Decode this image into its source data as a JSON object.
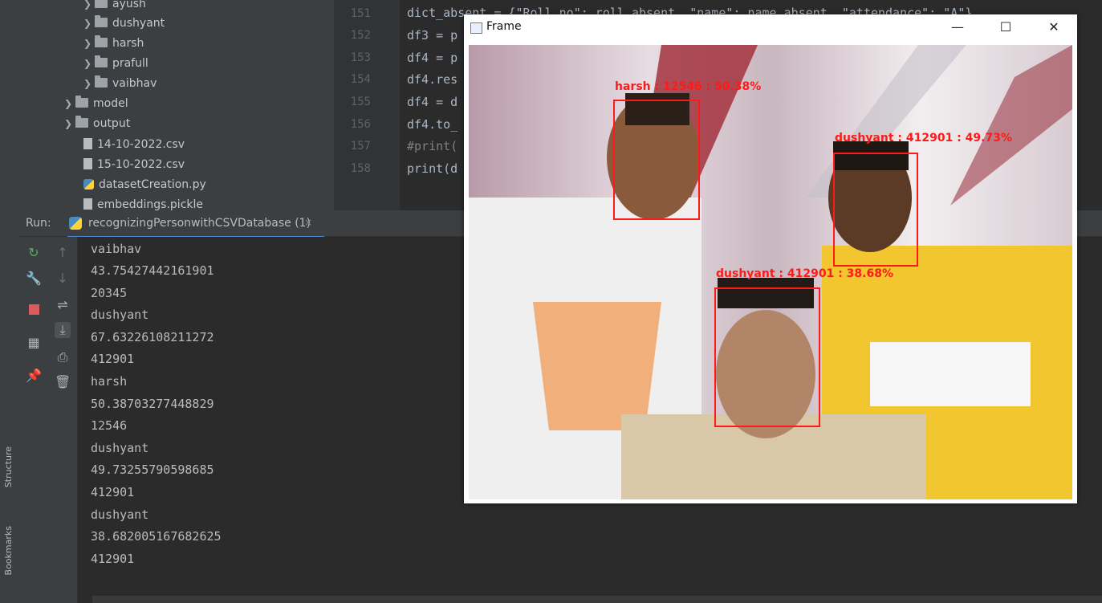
{
  "side_tabs": {
    "structure": "Structure",
    "bookmarks": "Bookmarks"
  },
  "project_tree": [
    {
      "label": "ayush",
      "type": "folder",
      "depth": 2
    },
    {
      "label": "dushyant",
      "type": "folder",
      "depth": 2
    },
    {
      "label": "harsh",
      "type": "folder",
      "depth": 2
    },
    {
      "label": "prafull",
      "type": "folder",
      "depth": 2
    },
    {
      "label": "vaibhav",
      "type": "folder",
      "depth": 2
    },
    {
      "label": "model",
      "type": "folder",
      "depth": 1
    },
    {
      "label": "output",
      "type": "folder",
      "depth": 1
    },
    {
      "label": "14-10-2022.csv",
      "type": "file",
      "depth": 1
    },
    {
      "label": "15-10-2022.csv",
      "type": "file",
      "depth": 1
    },
    {
      "label": "datasetCreation.py",
      "type": "python",
      "depth": 1
    },
    {
      "label": "embeddings.pickle",
      "type": "file",
      "depth": 1
    }
  ],
  "editor": {
    "line_numbers": [
      "151",
      "152",
      "153",
      "154",
      "155",
      "156",
      "157",
      "158"
    ],
    "lines": [
      "dict_absent = {\"Roll_no\": roll_absent, \"name\": name_absent, \"attendance\": \"A\"}",
      "df3 = p",
      "df4 = p",
      "df4.res",
      "df4 = d",
      "df4.to_",
      "#print(",
      "print(d"
    ]
  },
  "run": {
    "label": "Run:",
    "tab": "recognizingPersonwithCSVDatabase (1)",
    "close": "×"
  },
  "console_output": [
    "vaibhav",
    "43.75427442161901",
    "20345",
    "dushyant",
    "67.63226108211272",
    "412901",
    "harsh",
    "50.38703277448829",
    "12546",
    "dushyant",
    "49.73255790598685",
    "412901",
    "dushyant",
    "38.682005167682625",
    "412901"
  ],
  "frame_window": {
    "title": "Frame",
    "minimize": "—",
    "maximize": "☐",
    "close": "✕",
    "detections": [
      {
        "label": "harsh : 12546 : 50.38%"
      },
      {
        "label": "dushyant : 412901 : 49.73%"
      },
      {
        "label": "dushyant : 412901 : 38.68%"
      }
    ],
    "box_color": "#ff1a1a"
  }
}
